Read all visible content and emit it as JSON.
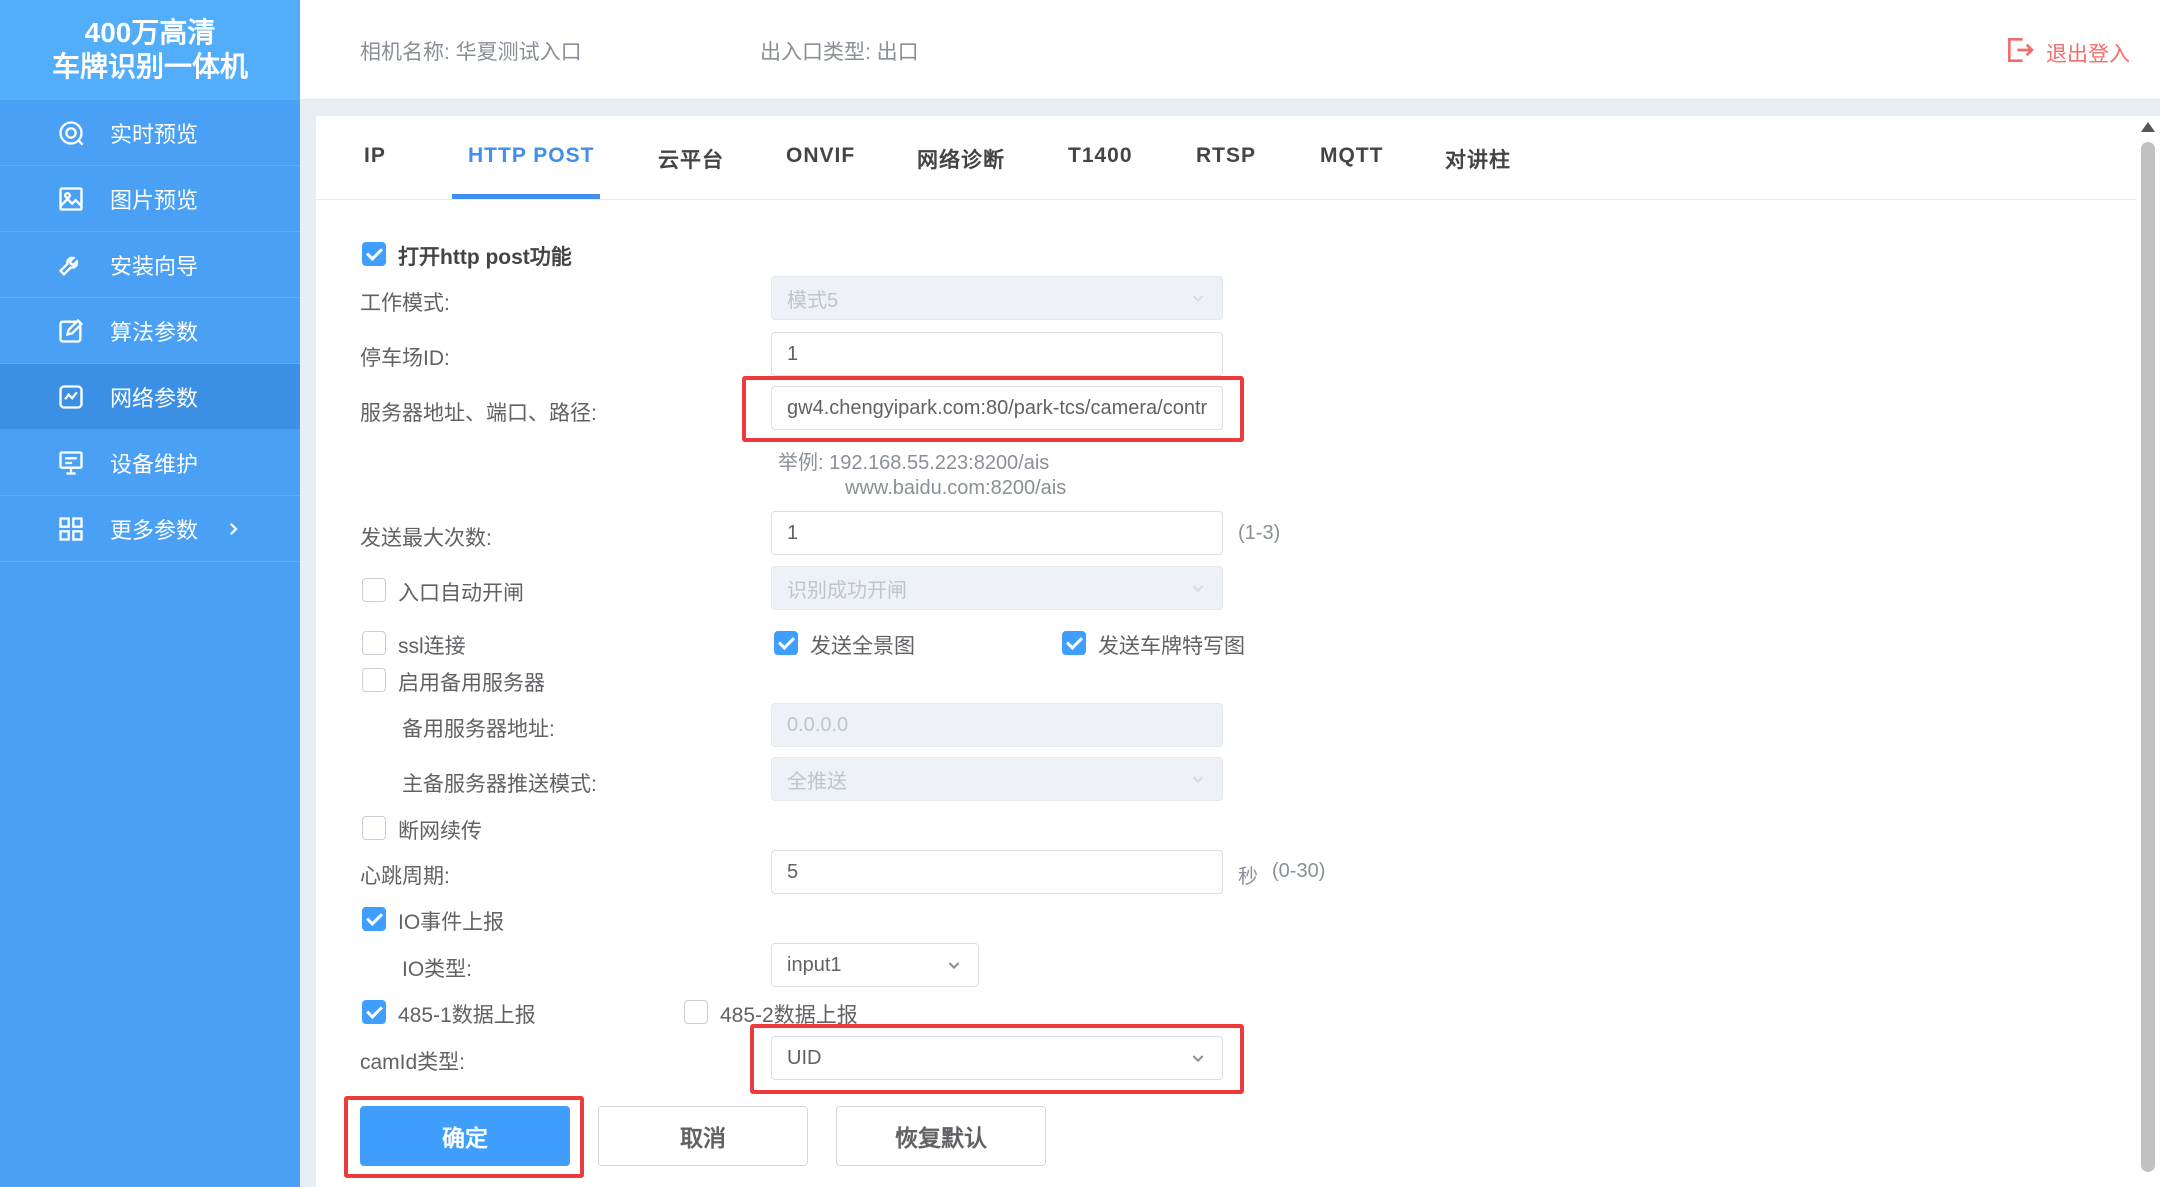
{
  "sidebar": {
    "brand_line1": "400万高清",
    "brand_line2": "车牌识别一体机",
    "items": [
      {
        "label": "实时预览",
        "icon": "live-preview-icon"
      },
      {
        "label": "图片预览",
        "icon": "image-icon"
      },
      {
        "label": "安装向导",
        "icon": "wrench-icon"
      },
      {
        "label": "算法参数",
        "icon": "edit-icon"
      },
      {
        "label": "网络参数",
        "icon": "network-icon"
      },
      {
        "label": "设备维护",
        "icon": "device-icon"
      },
      {
        "label": "更多参数",
        "icon": "grid-icon"
      }
    ],
    "active_index": 4
  },
  "header": {
    "camera_name": "相机名称: 华夏测试入口",
    "io_type": "出入口类型: 出口",
    "logout": "退出登入"
  },
  "tabs": [
    {
      "label": "IP"
    },
    {
      "label": "HTTP POST"
    },
    {
      "label": "云平台"
    },
    {
      "label": "ONVIF"
    },
    {
      "label": "网络诊断"
    },
    {
      "label": "T1400"
    },
    {
      "label": "RTSP"
    },
    {
      "label": "MQTT"
    },
    {
      "label": "对讲柱"
    }
  ],
  "active_tab": "HTTP POST",
  "form": {
    "enable_http_post": {
      "label": "打开http post功能",
      "checked": true
    },
    "work_mode": {
      "label": "工作模式:",
      "value": "模式5"
    },
    "parking_id": {
      "label": "停车场ID:",
      "value": "1"
    },
    "server_address": {
      "label": "服务器地址、端口、路径:",
      "value": "gw4.chengyipark.com:80/park-tcs/camera/contr"
    },
    "example_line1": "举例:  192.168.55.223:8200/ais",
    "example_line2": "www.baidu.com:8200/ais",
    "max_send": {
      "label": "发送最大次数:",
      "value": "1",
      "hint": "(1-3)"
    },
    "entry_auto_open": {
      "label": "入口自动开闸",
      "checked": false,
      "value": "识别成功开闸"
    },
    "ssl": {
      "label": "ssl连接",
      "checked": false
    },
    "send_full_image": {
      "label": "发送全景图",
      "checked": true
    },
    "send_plate_image": {
      "label": "发送车牌特写图",
      "checked": true
    },
    "enable_backup": {
      "label": "启用备用服务器",
      "checked": false
    },
    "backup_address": {
      "label": "备用服务器地址:",
      "value": "0.0.0.0"
    },
    "push_mode": {
      "label": "主备服务器推送模式:",
      "value": "全推送"
    },
    "resume_upload": {
      "label": "断网续传",
      "checked": false
    },
    "heartbeat": {
      "label": "心跳周期:",
      "value": "5",
      "unit": "秒",
      "hint": "(0-30)"
    },
    "io_event": {
      "label": "IO事件上报",
      "checked": true
    },
    "io_type": {
      "label": "IO类型:",
      "value": "input1"
    },
    "rs485_1": {
      "label": "485-1数据上报",
      "checked": true
    },
    "rs485_2": {
      "label": "485-2数据上报",
      "checked": false
    },
    "camid_type": {
      "label": "camId类型:",
      "value": "UID"
    }
  },
  "buttons": {
    "confirm": "确定",
    "cancel": "取消",
    "restore": "恢复默认"
  },
  "colors": {
    "sidebar": "#4aa0f5",
    "accent": "#409eff",
    "highlight": "#ee3a3a",
    "logout": "#f56c6c"
  }
}
